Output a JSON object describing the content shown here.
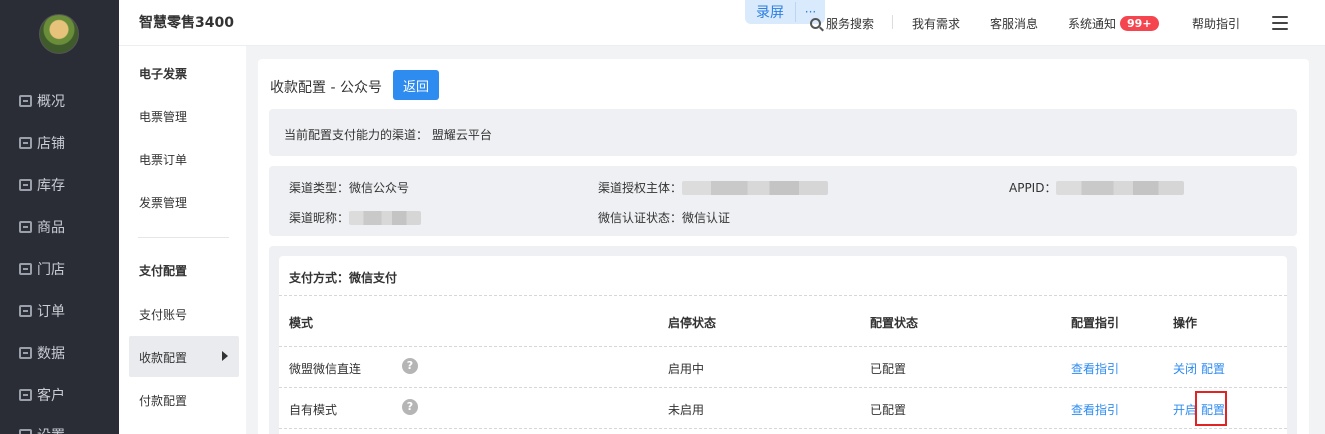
{
  "sidebar": {
    "items": [
      {
        "label": "概况",
        "icon": "overview-icon"
      },
      {
        "label": "店铺",
        "icon": "store-icon"
      },
      {
        "label": "库存",
        "icon": "inventory-icon"
      },
      {
        "label": "商品",
        "icon": "goods-icon"
      },
      {
        "label": "门店",
        "icon": "shop-icon"
      },
      {
        "label": "订单",
        "icon": "order-icon"
      },
      {
        "label": "数据",
        "icon": "data-icon"
      },
      {
        "label": "客户",
        "icon": "customer-icon"
      },
      {
        "label": "设置",
        "icon": "settings-icon"
      }
    ]
  },
  "header": {
    "title": "智慧零售3400",
    "record_label": "录屏",
    "record_more": "···",
    "nav": {
      "service_search": "服务搜索",
      "my_needs": "我有需求",
      "cs_message": "客服消息",
      "system_notice": "系统通知",
      "notice_badge": "99+",
      "help": "帮助指引"
    }
  },
  "submenu": {
    "e_invoice_head": "电子发票",
    "e_invoice_manage": "电票管理",
    "e_invoice_order": "电票订单",
    "invoice_manage": "发票管理",
    "pay_config_head": "支付配置",
    "pay_account": "支付账号",
    "collect_config": "收款配置",
    "pay_out_config": "付款配置"
  },
  "page": {
    "title": "收款配置 - 公众号",
    "back_label": "返回",
    "notice": "当前配置支付能力的渠道：   盟耀云平台",
    "info": {
      "channel_type": "渠道类型：微信公众号",
      "channel_auth": "渠道授权主体：",
      "appid": "APPID：",
      "channel_nickname": "渠道昵称：",
      "wechat_verify": "微信认证状态：微信认证"
    },
    "pay_title": "支付方式：微信支付",
    "table": {
      "headers": [
        "模式",
        "启停状态",
        "配置状态",
        "配置指引",
        "操作"
      ],
      "rows": [
        {
          "mode": "微盟微信直连",
          "status": "启用中",
          "config": "已配置",
          "guide": "查看指引",
          "op1": "关闭",
          "op2": "配置"
        },
        {
          "mode": "自有模式",
          "status": "未启用",
          "config": "已配置",
          "guide": "查看指引",
          "op1": "开启",
          "op2": "配置"
        }
      ]
    }
  },
  "colors": {
    "sidebar_bg": "#2a2d36",
    "primary": "#2e8cf0",
    "badge": "#f5454f",
    "highlight": "#e02424"
  }
}
